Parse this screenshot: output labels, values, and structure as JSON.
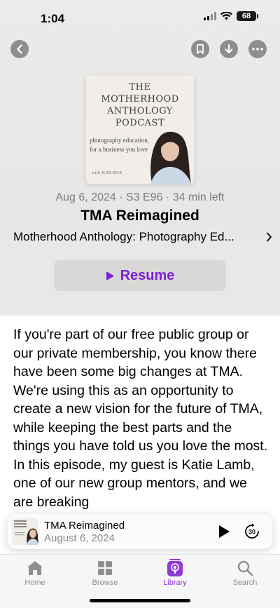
{
  "status_bar": {
    "time": "1:04",
    "battery": "68"
  },
  "header_actions": {
    "back_icon": "chevron-left-icon",
    "bookmark_icon": "bookmark-icon",
    "download_icon": "download-icon",
    "more_icon": "ellipsis-icon"
  },
  "artwork": {
    "title_line1": "THE",
    "title_line2": "MOTHERHOOD",
    "title_line3": "ANTHOLOGY",
    "title_line4": "PODCAST",
    "tagline_line1": "photography education,",
    "tagline_line2": "for a business you love",
    "with": "with KIM BOX"
  },
  "episode": {
    "meta": "Aug 6, 2024 · S3 E96 · 34 min left",
    "title": "TMA Reimagined",
    "show": "Motherhood Anthology: Photography Ed...",
    "resume_label": "Resume",
    "description": "If you're part of our free public group or our private membership, you know there have been some big changes at TMA. We're using this as an opportunity to create a new vision for the future of TMA, while keeping the best parts and the things you have told us you love the most. In this episode, my guest is Katie Lamb, one of our new group mentors, and we are breaking"
  },
  "mini_player": {
    "title": "TMA Reimagined",
    "date": "August 6, 2024",
    "skip_label": "30"
  },
  "tabs": [
    {
      "label": "Home",
      "icon": "house-icon"
    },
    {
      "label": "Browse",
      "icon": "grid-icon"
    },
    {
      "label": "Library",
      "icon": "library-podcast-icon",
      "active": true
    },
    {
      "label": "Search",
      "icon": "search-icon"
    }
  ],
  "colors": {
    "accent": "#8e3ad8",
    "resume_text": "#7a1fd1"
  }
}
